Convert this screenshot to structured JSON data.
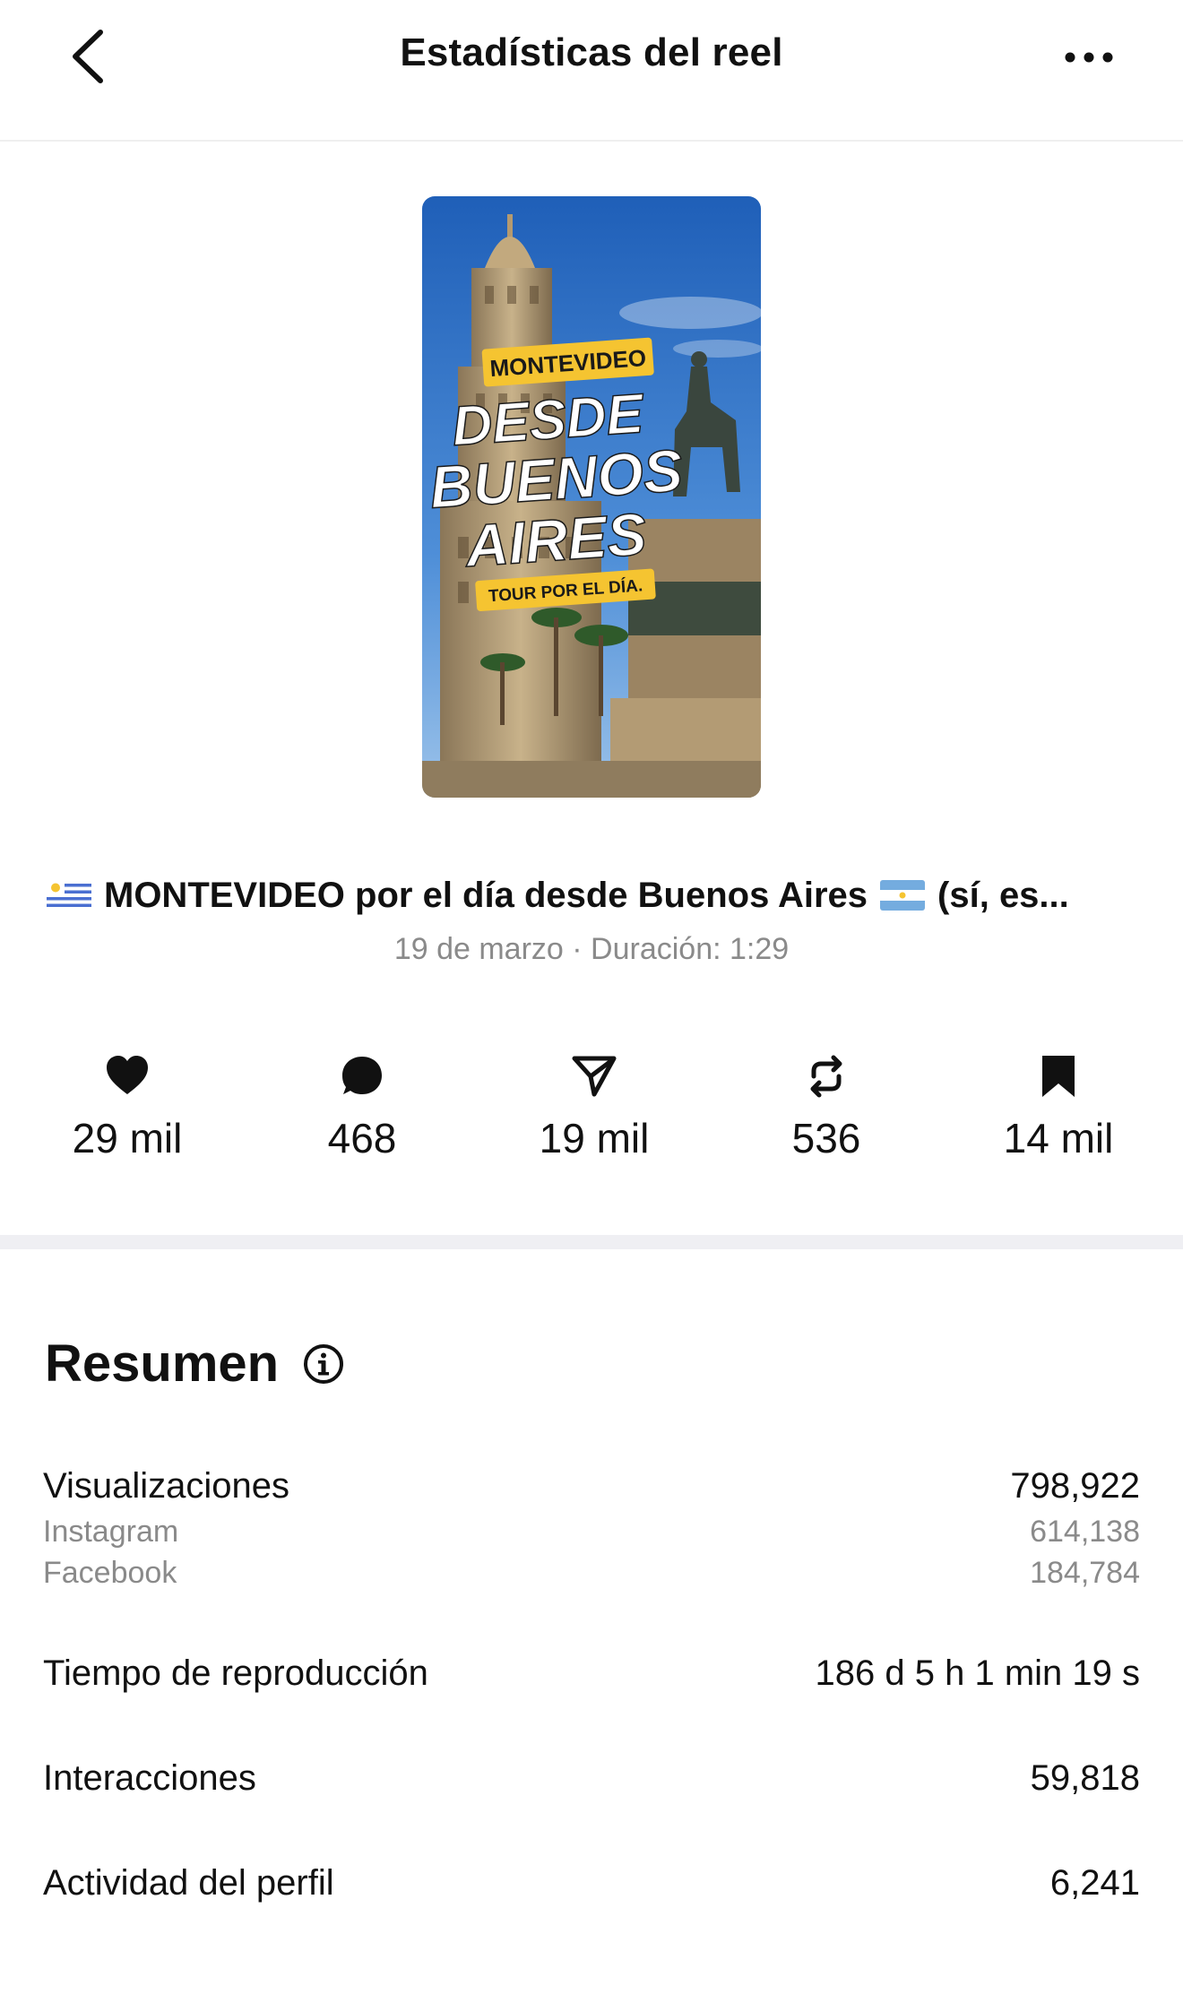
{
  "header": {
    "title": "Estadísticas del reel"
  },
  "thumbnail": {
    "label_top": "MONTEVIDEO",
    "line1": "DESDE",
    "line2": "BUENOS",
    "line3": "AIRES",
    "label_bottom": "TOUR POR EL DÍA."
  },
  "caption": {
    "text": "MONTEVIDEO por el día desde Buenos Aires",
    "tail": "(sí, es...",
    "meta": "19 de marzo · Duración: 1:29"
  },
  "stats": [
    {
      "icon": "heart-icon",
      "value": "29 mil"
    },
    {
      "icon": "comment-icon",
      "value": "468"
    },
    {
      "icon": "share-icon",
      "value": "19 mil"
    },
    {
      "icon": "repost-icon",
      "value": "536"
    },
    {
      "icon": "save-icon",
      "value": "14 mil"
    }
  ],
  "summary": {
    "title": "Resumen",
    "views": {
      "label": "Visualizaciones",
      "value": "798,922"
    },
    "instagram": {
      "label": "Instagram",
      "value": "614,138"
    },
    "facebook": {
      "label": "Facebook",
      "value": "184,784"
    },
    "watch_time": {
      "label": "Tiempo de reproducción",
      "value": "186 d 5 h 1 min 19 s"
    },
    "interactions": {
      "label": "Interacciones",
      "value": "59,818"
    },
    "profile_activity": {
      "label": "Actividad del perfil",
      "value": "6,241"
    }
  },
  "colors": {
    "accent_yellow": "#f5c431",
    "muted_text": "#8a8a8a",
    "divider": "#efeff3"
  }
}
